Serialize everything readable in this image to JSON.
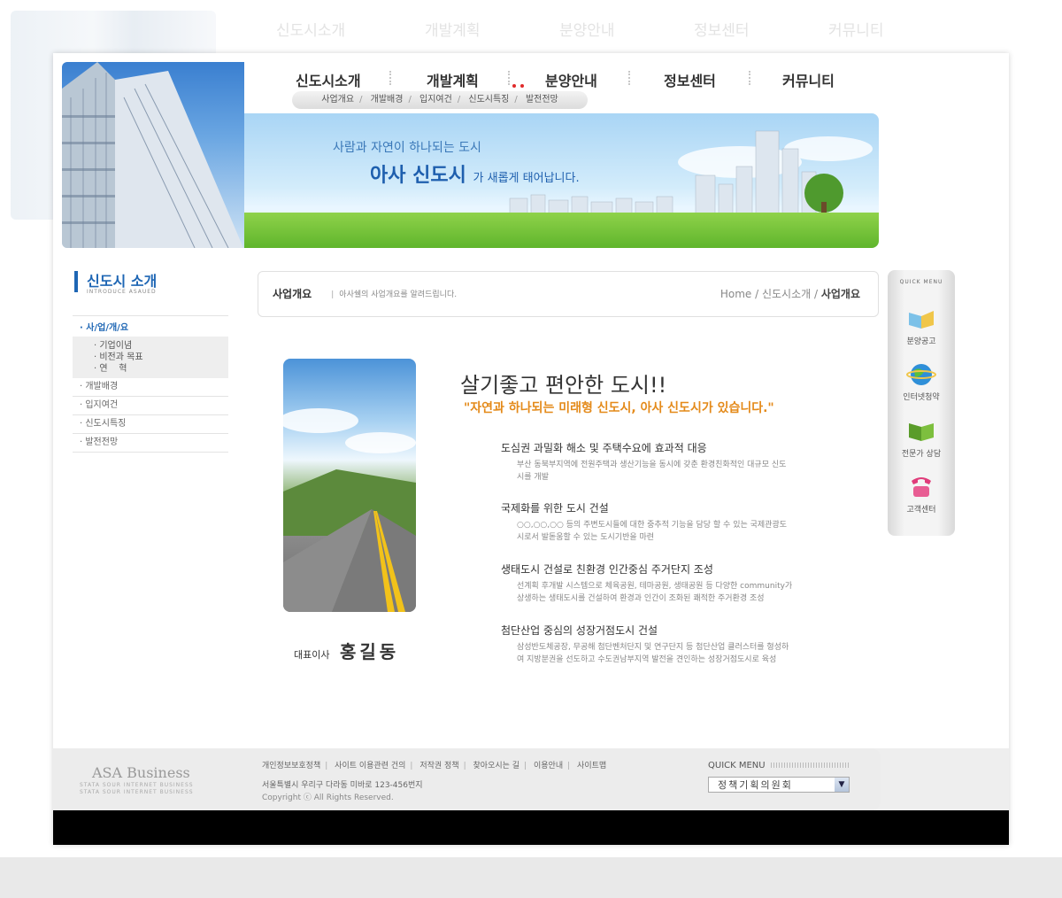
{
  "gnb": {
    "items": [
      "신도시소개",
      "개발계획",
      "분양안내",
      "정보센터",
      "커뮤니티"
    ],
    "subnav": [
      "사업개요",
      "개발배경",
      "입지여건",
      "신도시특징",
      "발전전망"
    ]
  },
  "banner": {
    "slogan_top": "사람과 자연이 하나되는 도시",
    "slogan_main": "아사 신도시",
    "slogan_tail": "가 새롭게 태어납니다."
  },
  "lnb": {
    "title": "신도시 소개",
    "title_en": "INTRODUCE ASAUED",
    "active": "· 사/업/개/요",
    "sub_items": [
      "· 기업이념",
      "· 비전과 목표",
      "· 연    혁"
    ],
    "items": [
      "· 개발배경",
      "· 입지여건",
      "· 신도시특징",
      "· 발전전망"
    ]
  },
  "location": {
    "title": "사업개요",
    "desc": "아사쉘의 사업개요를 알려드립니다.",
    "path_home": "Home / 신도시소개 / ",
    "path_current": "사업개요"
  },
  "ceo": {
    "label": "대표이사",
    "signature": "홍길동"
  },
  "content": {
    "headline": "살기좋고 편안한 도시!!",
    "subheadline": "\"자연과 하나되는 미래형 신도시, 아사 신도시가 있습니다.\"",
    "points": [
      {
        "title": "도심권 과밀화 해소 및 주택수요에 효과적 대응",
        "body": "부산 동북부지역에 전원주택과 생산기능을 동시에 갖춘 환경친화적인 대규모 신도시를 개발"
      },
      {
        "title": "국제화를 위한 도시 건설",
        "body": "○○,○○,○○ 등의 주변도시들에 대한 중추적 기능을 담당 할 수 있는 국제관광도시로서 발돋움할 수 있는 도시기반을 마련"
      },
      {
        "title": "생태도시 건설로 친환경 인간중심 주거단지 조성",
        "body": "선계획 후개발 시스템으로 체육공원, 테마공원, 생태공원 등 다양한 community가 상생하는 생태도시를 건설하여 환경과 인간이 조화된 쾌적한 주거환경 조성"
      },
      {
        "title": "첨단산업 중심의 성장거점도시 건설",
        "body": "삼성반도체공장, 무공해 첨단벤처단지 및 연구단지 등 첨단산업 클러스터를 형성하여 지방분권을 선도하고 수도권남부지역 발전을 견인하는 성장거점도시로 육성"
      }
    ]
  },
  "quick_menu": {
    "title": "QUICK MENU",
    "items": [
      "분양공고",
      "인터넷청약",
      "전문가 상담",
      "고객센터"
    ]
  },
  "footer": {
    "logo": "ASA Business",
    "logo_sub1": "STATA SOUR INTERNET BUSINESS",
    "logo_sub2": "STATA SOUR INTERNET BUSINESS",
    "links": [
      "개인정보보호정책",
      "사이트 이용관련 건의",
      "저작권 정책",
      "찾아오시는 길",
      "이용안내",
      "사이트맵"
    ],
    "address": "서울특별시 우리구 다라동 미바로 123-456번지",
    "copyright": "Copyright ⓒ All Rights Reserved.",
    "quick_label": "QUICK MENU",
    "select_value": "정책기획의원회"
  },
  "colors": {
    "accent": "#1e66b4",
    "highlight": "#e48a1a",
    "footer_bg": "#eeeeee"
  }
}
